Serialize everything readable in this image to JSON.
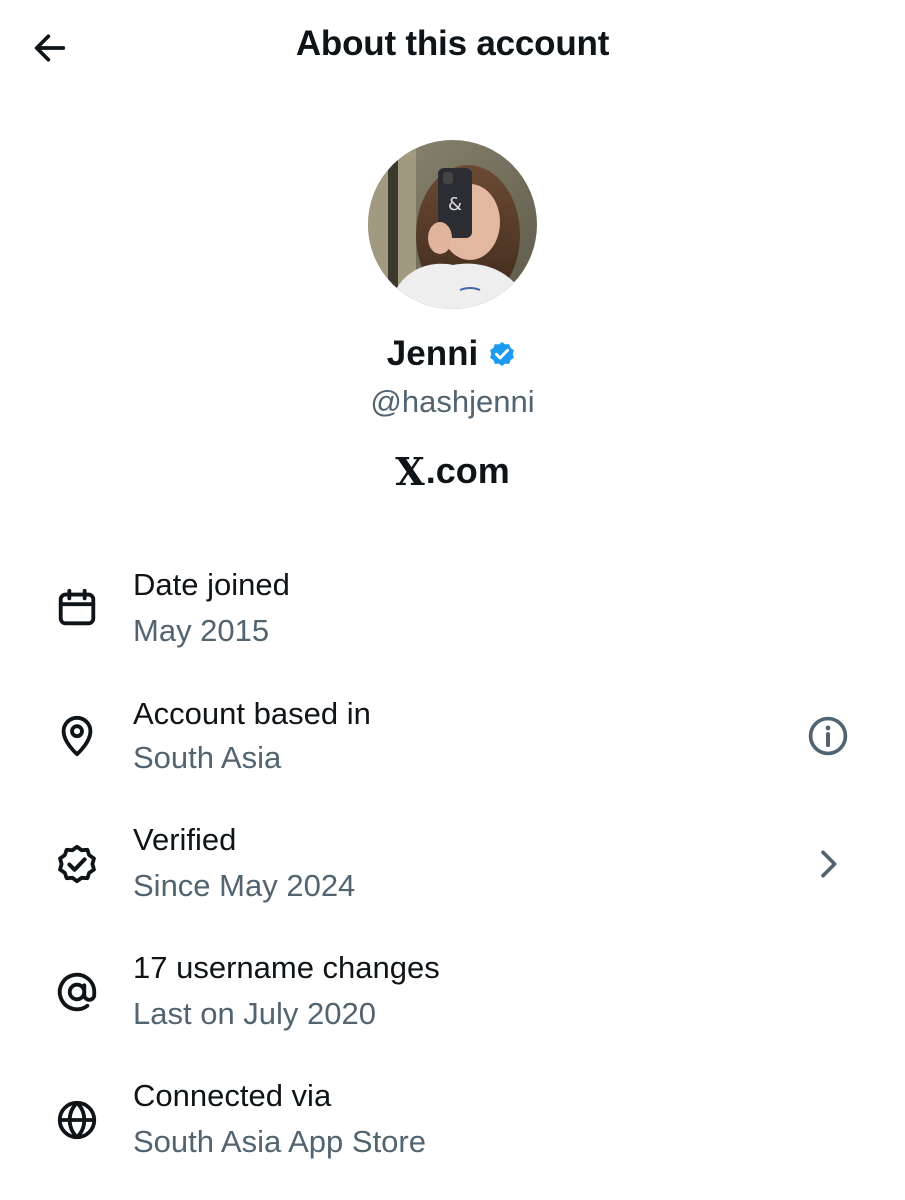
{
  "header": {
    "title": "About this account",
    "back_icon": "arrow-left-icon"
  },
  "profile": {
    "display_name": "Jenni",
    "handle": "@hashjenni",
    "site": ".com",
    "site_logo": "X",
    "verified_color": "#1d9bf0"
  },
  "rows": [
    {
      "icon": "calendar-icon",
      "title": "Date joined",
      "subtitle": "May 2015"
    },
    {
      "icon": "location-pin-icon",
      "title": "Account based in",
      "subtitle": "South Asia",
      "action_icon": "info-icon"
    },
    {
      "icon": "verified-badge-outline-icon",
      "title": "Verified",
      "subtitle": "Since May 2024",
      "action_icon": "chevron-right-icon"
    },
    {
      "icon": "at-sign-icon",
      "title": "17 username changes",
      "subtitle": "Last on July 2020"
    },
    {
      "icon": "globe-icon",
      "title": "Connected via",
      "subtitle": "South Asia App Store"
    }
  ],
  "colors": {
    "text_primary": "#0f1419",
    "text_secondary": "#536471",
    "verified_blue": "#1d9bf0"
  }
}
